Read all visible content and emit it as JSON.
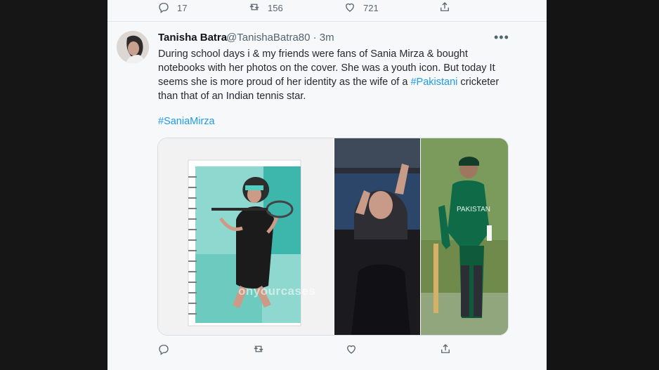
{
  "top_actions": {
    "replies": "17",
    "retweets": "156",
    "likes": "721"
  },
  "tweet": {
    "author_name": "Tanisha Batra",
    "author_handle": "@TanishaBatra80 · 3m",
    "text_before_tag": "During school days i & my friends were fans of Sania Mirza & bought notebooks with her photos on the cover. She was a youth icon. But today It seems she is more proud of her identity as the wife of a ",
    "inline_hashtag": "#Pakistani",
    "text_after_tag": " cricketer than that of an Indian tennis star.",
    "hashtag_line": "#SaniaMirza",
    "watermark": "onyourcases"
  },
  "icons": {
    "reply": "reply-icon",
    "retweet": "retweet-icon",
    "like": "heart-icon",
    "share": "share-icon",
    "more": "more-icon"
  }
}
